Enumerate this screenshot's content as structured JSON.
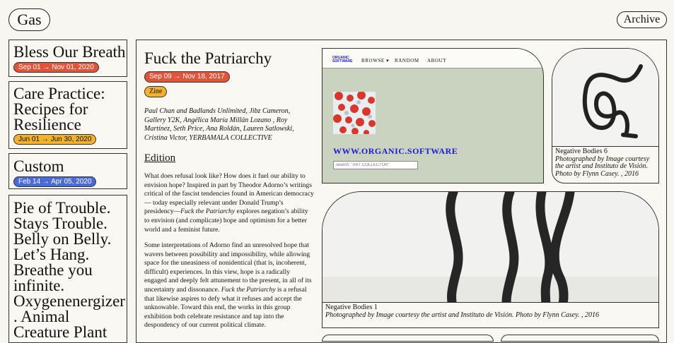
{
  "header": {
    "logo": "Gas",
    "archive_label": "Archive"
  },
  "sidebar": {
    "items": [
      {
        "title": "Bless Our Breath",
        "dates": "Sep 01 → Nov 01, 2020",
        "color": "red"
      },
      {
        "title": "Care Practice: Recipes for Resilience",
        "dates": "Jun 01 → Jun 30, 2020",
        "color": "yellow"
      },
      {
        "title": "Custom",
        "dates": "Feb 14 → Apr 05, 2020",
        "color": "blue"
      },
      {
        "title": "Pie of Trouble. Stays Trouble. Belly on Belly. Let’s Hang. Breathe you infinite. Oxygenenergizer . Animal Creature Plant"
      }
    ]
  },
  "detail": {
    "title": "Fuck the Patriarchy",
    "dates": "Sep 09 → Nov 18, 2017",
    "type": "Zine",
    "credits": "Paul Chan and Badlands Unlimited, Jibz Cameron, Gallery Y2K, Angélica María Millán Lozano , Roy Martínez, Seth Price, Ana Roldán, Lauren Satlowski, Cristina Victor, YERBAMALA COLLECTIVE",
    "section_heading": "Edition",
    "para1_a": "What does refusal look like? How does it fuel our ability to envision hope? Inspired in part by Theodor Adorno’s writings critical of the fascist tendencies found in American democracy— today especially relevant under Donald Trump’s presidency—",
    "para1_em": "Fuck the Patriarchy",
    "para1_b": " explores negation’s ability to envision (and complicate) hope and optimism for a better world and a feminist future.",
    "para2_a": "Some interpretations of Adorno find an unresolved hope that wavers between possibility and impossibility, while allowing space for the uneasiness of nonidentical (that is, incoherent, difficult) experiences. In this view, hope is a radically engaged and deeply felt attunement to the present, in all of its uncertainty and dissonance. ",
    "para2_em": "Fuck the Patriarchy",
    "para2_b": " is a refusal that likewise aspires to defy what it refuses and accept the unknowable. Toward this end, the works in this group exhibition both celebrate resistance and tap into the despondency of our current political climate."
  },
  "gallery": {
    "website": {
      "logo_line1": "ORGANIC",
      "logo_line2": "SOFTWARE",
      "nav": [
        "BROWSE ▾",
        "RANDOM",
        "ABOUT"
      ],
      "url": "WWW.ORGANIC.SOFTWARE",
      "search_placeholder": "search: \"ART COLLECTOR\""
    },
    "card1": {
      "title": "Negative Bodies 6",
      "caption": "Photographed by Image courtesy the artist and Instituto de Visión. Photo by Flynn Casey. , 2016"
    },
    "card2": {
      "title": "Negative Bodies 1",
      "caption": "Photographed by Image courtesy the artist and Instituto de Visión. Photo by Flynn Casey. , 2016"
    }
  },
  "colors": {
    "red": "#e0553a",
    "yellow": "#f2b32a",
    "blue": "#4a6ad8",
    "site_green": "#c9d3c0",
    "site_link": "#1d1ad6"
  }
}
